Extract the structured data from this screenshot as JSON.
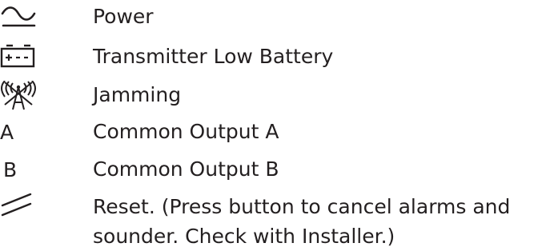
{
  "legend": {
    "items": [
      {
        "icon": "power-wave-icon",
        "symbol": "",
        "label": "Power"
      },
      {
        "icon": "battery-icon",
        "symbol": "",
        "label": "Transmitter Low Battery"
      },
      {
        "icon": "jamming-antenna-icon",
        "symbol": "",
        "label": "Jamming"
      },
      {
        "icon": "",
        "symbol": "A",
        "label": "Common Output A"
      },
      {
        "icon": "",
        "symbol": "B",
        "label": "Common Output B"
      },
      {
        "icon": "reset-slash-icon",
        "symbol": "",
        "label": "Reset. (Press button to cancel alarms and sounder. Check with Installer.)"
      }
    ]
  },
  "colors": {
    "text": "#231f20",
    "background": "#ffffff"
  }
}
